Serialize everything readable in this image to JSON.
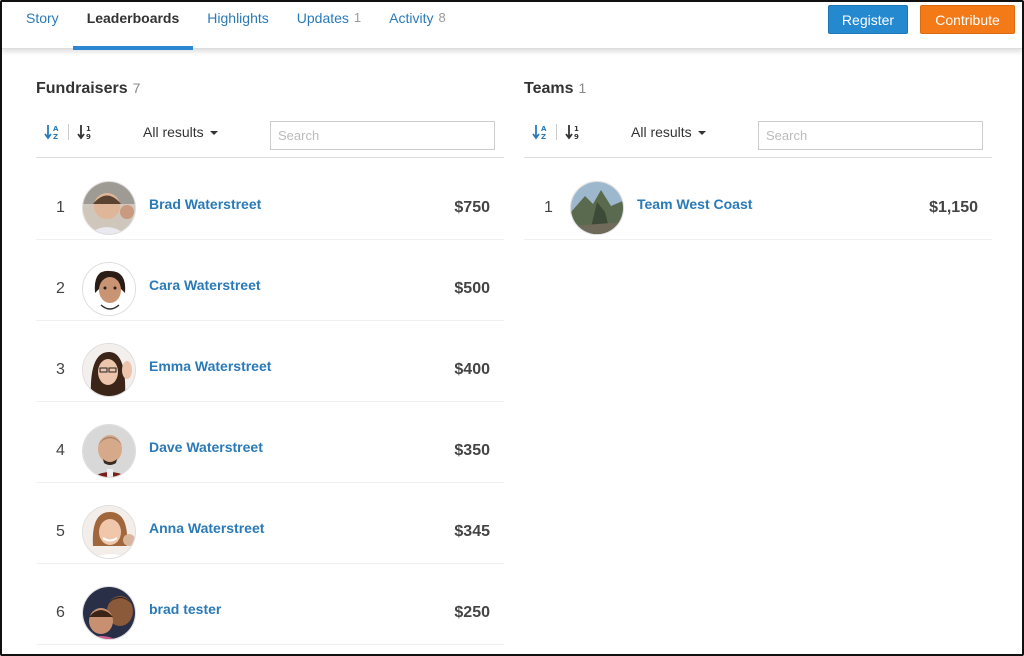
{
  "nav": {
    "tabs": [
      {
        "label": "Story",
        "count": ""
      },
      {
        "label": "Leaderboards",
        "count": ""
      },
      {
        "label": "Highlights",
        "count": ""
      },
      {
        "label": "Updates",
        "count": "1"
      },
      {
        "label": "Activity",
        "count": "8"
      }
    ],
    "register_label": "Register",
    "contribute_label": "Contribute"
  },
  "colors": {
    "link_blue": "#2a7ab8",
    "register_blue": "#2589d0",
    "contribute_orange": "#f47a18",
    "active_underline": "#2b87d1"
  },
  "fundraisers": {
    "title": "Fundraisers",
    "count": "7",
    "filter_label": "All results",
    "search_placeholder": "Search",
    "rows": [
      {
        "rank": "1",
        "name": "Brad Waterstreet",
        "amount": "$750"
      },
      {
        "rank": "2",
        "name": "Cara Waterstreet",
        "amount": "$500"
      },
      {
        "rank": "3",
        "name": "Emma Waterstreet",
        "amount": "$400"
      },
      {
        "rank": "4",
        "name": "Dave Waterstreet",
        "amount": "$350"
      },
      {
        "rank": "5",
        "name": "Anna Waterstreet",
        "amount": "$345"
      },
      {
        "rank": "6",
        "name": "brad tester",
        "amount": "$250"
      }
    ]
  },
  "teams": {
    "title": "Teams",
    "count": "1",
    "filter_label": "All results",
    "search_placeholder": "Search",
    "rows": [
      {
        "rank": "1",
        "name": "Team West Coast",
        "amount": "$1,150"
      }
    ]
  },
  "icons": {
    "sort_alpha": "sort-alpha-icon",
    "sort_numeric": "sort-numeric-icon",
    "caret": "caret-down-icon",
    "avatar": "avatar-photo"
  }
}
